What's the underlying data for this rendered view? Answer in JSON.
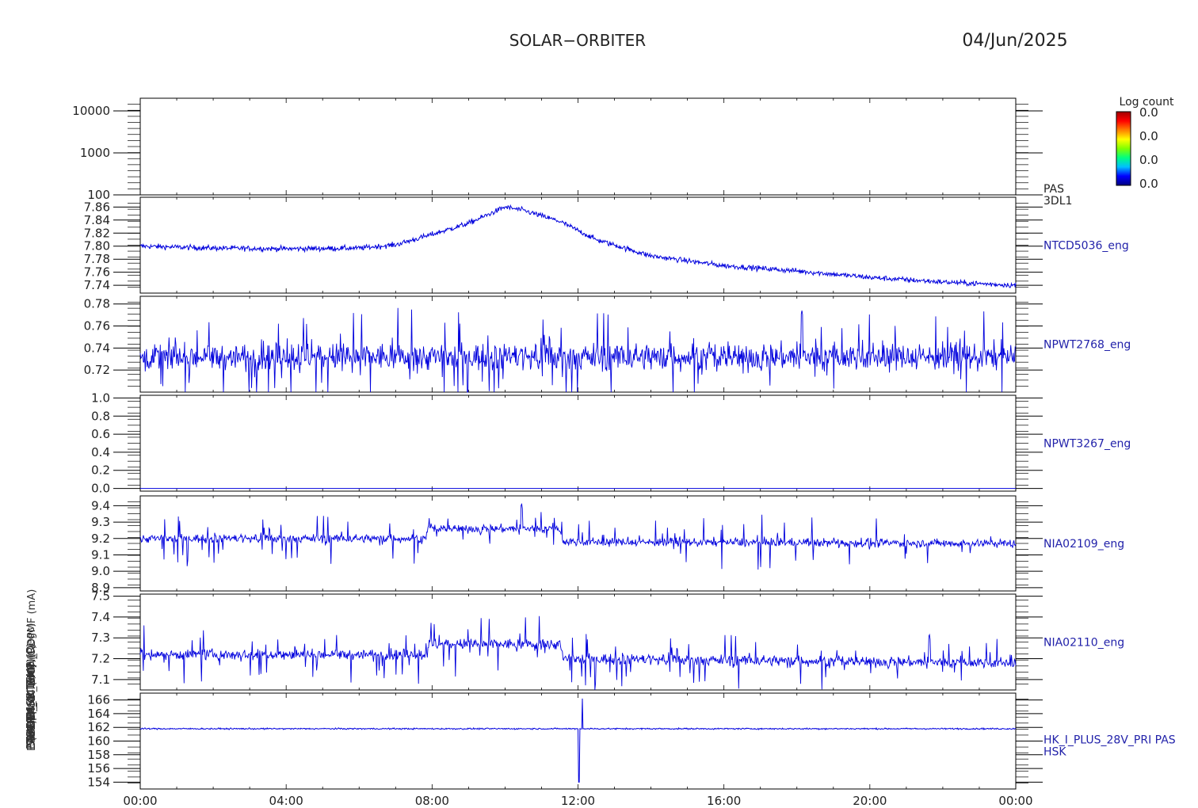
{
  "header": {
    "mission": "SOLAR−ORBITER",
    "date": "04/Jun/2025"
  },
  "x_axis": {
    "tick_labels": [
      "00:00",
      "04:00",
      "08:00",
      "12:00",
      "16:00",
      "20:00",
      "00:00"
    ],
    "range_hours": [
      0,
      24
    ]
  },
  "colorbar": {
    "title": "Log count",
    "labels": [
      "0.0",
      "0.0",
      "0.0",
      "0.0"
    ],
    "colors": [
      "#000080",
      "#0000ff",
      "#00c0ff",
      "#00ff80",
      "#80ff00",
      "#ffff00",
      "#ff8000",
      "#ff0000",
      "#a00000"
    ]
  },
  "line_color": "#0000dd",
  "chart_data": [
    {
      "type": "heatmap",
      "right_label": [
        "PAS",
        "3DL1"
      ],
      "ylabel": "E (eV)",
      "scale": "log",
      "ylim": [
        100,
        20000
      ],
      "y_ticks": [
        {
          "v": 100,
          "label": "100"
        },
        {
          "v": 1000,
          "label": "1000"
        },
        {
          "v": 10000,
          "label": "10000"
        }
      ],
      "values": []
    },
    {
      "type": "line",
      "right_label": [
        "NTCD5036_eng"
      ],
      "ylabel": "PAS approx Temp (Degc)",
      "ylim": [
        7.728,
        7.875
      ],
      "y_ticks": [
        {
          "v": 7.74,
          "label": "7.74"
        },
        {
          "v": 7.76,
          "label": "7.76"
        },
        {
          "v": 7.78,
          "label": "7.78"
        },
        {
          "v": 7.8,
          "label": "7.80"
        },
        {
          "v": 7.82,
          "label": "7.82"
        },
        {
          "v": 7.84,
          "label": "7.84"
        },
        {
          "v": 7.86,
          "label": "7.86"
        }
      ],
      "series": [
        {
          "x_hours": [
            0,
            2,
            4,
            6,
            7,
            8,
            9,
            10,
            10.5,
            11.5,
            12.5,
            14,
            16,
            18,
            20,
            22,
            24
          ],
          "values": [
            7.8,
            7.797,
            7.796,
            7.797,
            7.802,
            7.818,
            7.835,
            7.86,
            7.855,
            7.838,
            7.81,
            7.785,
            7.77,
            7.762,
            7.752,
            7.745,
            7.74
          ],
          "noise": 0.004
        }
      ]
    },
    {
      "type": "line",
      "right_label": [
        "NPWT2768_eng"
      ],
      "ylabel": "SWA-EAS1 TEMP (C)",
      "ylim": [
        0.7,
        0.787
      ],
      "y_ticks": [
        {
          "v": 0.72,
          "label": "0.72"
        },
        {
          "v": 0.74,
          "label": "0.74"
        },
        {
          "v": 0.76,
          "label": "0.76"
        },
        {
          "v": 0.78,
          "label": "0.78"
        }
      ],
      "series": [
        {
          "x_hours": [
            0,
            24
          ],
          "values": [
            0.732,
            0.732
          ],
          "noise": 0.012,
          "spikes": 0.045
        }
      ]
    },
    {
      "type": "line",
      "right_label": [
        "NPWT3267_eng"
      ],
      "ylabel": "SWA-EAS2 TEMP (C)",
      "ylim": [
        -0.03,
        1.03
      ],
      "y_ticks": [
        {
          "v": 0.0,
          "label": "0.0"
        },
        {
          "v": 0.2,
          "label": "0.2"
        },
        {
          "v": 0.4,
          "label": "0.4"
        },
        {
          "v": 0.6,
          "label": "0.6"
        },
        {
          "v": 0.8,
          "label": "0.8"
        },
        {
          "v": 1.0,
          "label": "1.0"
        }
      ],
      "series": [
        {
          "x_hours": [
            0,
            24
          ],
          "values": [
            0.0,
            0.0
          ],
          "noise": 0.0
        }
      ]
    },
    {
      "type": "line",
      "right_label": [
        "NIA02109_eng"
      ],
      "ylabel": "THERM_C4 (nC)",
      "ylim": [
        8.88,
        9.46
      ],
      "y_ticks": [
        {
          "v": 8.9,
          "label": "8.9"
        },
        {
          "v": 9.0,
          "label": "9.0"
        },
        {
          "v": 9.1,
          "label": "9.1"
        },
        {
          "v": 9.2,
          "label": "9.2"
        },
        {
          "v": 9.3,
          "label": "9.3"
        },
        {
          "v": 9.4,
          "label": "9.4"
        }
      ],
      "series": [
        {
          "x_hours": [
            0,
            7.8,
            7.9,
            11.5,
            11.6,
            24
          ],
          "values": [
            9.2,
            9.2,
            9.26,
            9.26,
            9.18,
            9.17
          ],
          "noise": 0.025,
          "spikes": 0.16
        }
      ]
    },
    {
      "type": "line",
      "right_label": [
        "NIA02110_eng"
      ],
      "ylabel": "THERM_MIL (nC)",
      "ylim": [
        7.05,
        7.51
      ],
      "y_ticks": [
        {
          "v": 7.1,
          "label": "7.1"
        },
        {
          "v": 7.2,
          "label": "7.2"
        },
        {
          "v": 7.3,
          "label": "7.3"
        },
        {
          "v": 7.4,
          "label": "7.4"
        },
        {
          "v": 7.5,
          "label": "7.5"
        }
      ],
      "series": [
        {
          "x_hours": [
            0,
            7.8,
            7.9,
            11.5,
            11.6,
            24
          ],
          "values": [
            7.22,
            7.22,
            7.27,
            7.27,
            7.2,
            7.18
          ],
          "noise": 0.025,
          "spikes": 0.14
        }
      ]
    },
    {
      "type": "line",
      "right_label": [
        "HK_I_PLUS_28V_PRI PAS",
        "HSK"
      ],
      "ylabel": "RPDM_HK_IMON_RDPMF (mA)",
      "ylim": [
        153,
        167
      ],
      "y_ticks": [
        {
          "v": 154,
          "label": "154"
        },
        {
          "v": 156,
          "label": "156"
        },
        {
          "v": 158,
          "label": "158"
        },
        {
          "v": 160,
          "label": "160"
        },
        {
          "v": 162,
          "label": "162"
        },
        {
          "v": 164,
          "label": "164"
        },
        {
          "v": 166,
          "label": "166"
        }
      ],
      "series": [
        {
          "x_hours": [
            0,
            24
          ],
          "values": [
            161.8,
            161.8
          ],
          "noise": 0.1,
          "events": [
            {
              "x": 12.02,
              "value": 154.0
            },
            {
              "x": 12.12,
              "value": 166.2
            }
          ]
        }
      ]
    }
  ]
}
